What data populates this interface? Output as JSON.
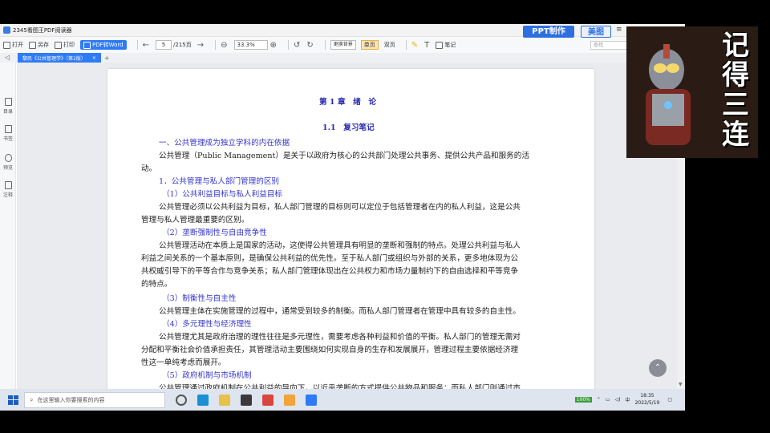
{
  "window": {
    "title": "2345看图王PDF阅读器"
  },
  "toolbar": {
    "open": "打开",
    "save_as": "另存",
    "print": "打印",
    "pdf_to_word": "PDF转Word",
    "current_page": "5",
    "total_pages": "/215页",
    "zoom": "33.3%",
    "change_bg": "更换背景",
    "single_page": "单页",
    "double_page": "双页",
    "note": "笔记",
    "search_placeholder": "查找"
  },
  "promo": {
    "ppt": "PPT制作",
    "meitu": "美图",
    "menu": "≡"
  },
  "tab": {
    "label": "黎民《公共管理学》（第2版）",
    "close": "×",
    "add": "+"
  },
  "sidebar": [
    {
      "label": "目录"
    },
    {
      "label": "书签"
    },
    {
      "label": "预览"
    },
    {
      "label": "注释"
    }
  ],
  "document": {
    "chapter": "第 1 章　绪　论",
    "section": "1.1　复习笔记",
    "lines": [
      "一、公共管理成为独立学科的内在依据",
      "公共管理（Public Management）是关于以政府为核心的公共部门处理公共事务、提供公共产品和服务的活",
      "动。",
      "1．公共管理与私人部门管理的区别",
      "（1）公共利益目标与私人利益目标",
      "公共管理必须以公共利益为目标，私人部门管理的目标则可以定位于包括管理者在内的私人利益，这是公共",
      "管理与私人管理最重要的区别。",
      "（2）垄断强制性与自由竞争性",
      "公共管理活动在本质上是国家的活动，这使得公共管理具有明显的垄断和强制的特点。处理公共利益与私人",
      "利益之间关系的一个基本原则，是确保公共利益的优先性。至于私人部门或组织与外部的关系，更多地体现为公",
      "共权威引导下的平等合作与竞争关系；私人部门管理体现出在公共权力和市场力量制约下的自由选择和平等竞争",
      "的特点。",
      "（3）制衡性与自主性",
      "公共管理主体在实施管理的过程中，通常受到较多的制衡。而私人部门管理者在管理中具有较多的自主性。",
      "（4）多元理性与经济理性",
      "公共管理尤其是政府治理的理性往往是多元理性，需要考虑各种利益和价值的平衡。私人部门的管理无需对",
      "分配和平衡社会价值承担责任，其管理活动主要围绕如何实现自身的生存和发展展开，管理过程主要依据经济理",
      "性这一单纯考虑而展开。",
      "（5）政府机制与市场机制",
      "公共管理通过政府机制在公共利益的导向下，以近乎垄断的方式提供公共物品和服务；而私人部门则通过市"
    ]
  },
  "taskbar": {
    "search_placeholder": "在这里输入你要搜索的内容",
    "battery": "100%",
    "ime": "中",
    "time": "18:35",
    "date": "2022/5/19"
  },
  "overlay": {
    "text": [
      "记",
      "得",
      "三",
      "连"
    ]
  },
  "colors": {
    "accent": "#2f7bf5",
    "link_blue": "#3333cc",
    "heading_blue": "#2a2ab0"
  }
}
